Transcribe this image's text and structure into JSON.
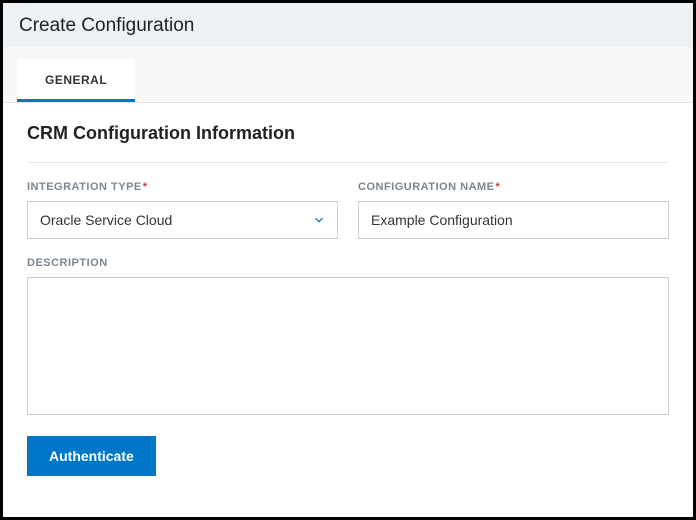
{
  "header": {
    "title": "Create Configuration"
  },
  "tabs": {
    "general": "GENERAL"
  },
  "section": {
    "title": "CRM Configuration Information"
  },
  "fields": {
    "integration_type": {
      "label": "INTEGRATION TYPE",
      "value": "Oracle Service Cloud"
    },
    "configuration_name": {
      "label": "CONFIGURATION NAME",
      "value": "Example Configuration"
    },
    "description": {
      "label": "DESCRIPTION",
      "value": ""
    }
  },
  "buttons": {
    "authenticate": "Authenticate"
  },
  "required_marker": "*"
}
